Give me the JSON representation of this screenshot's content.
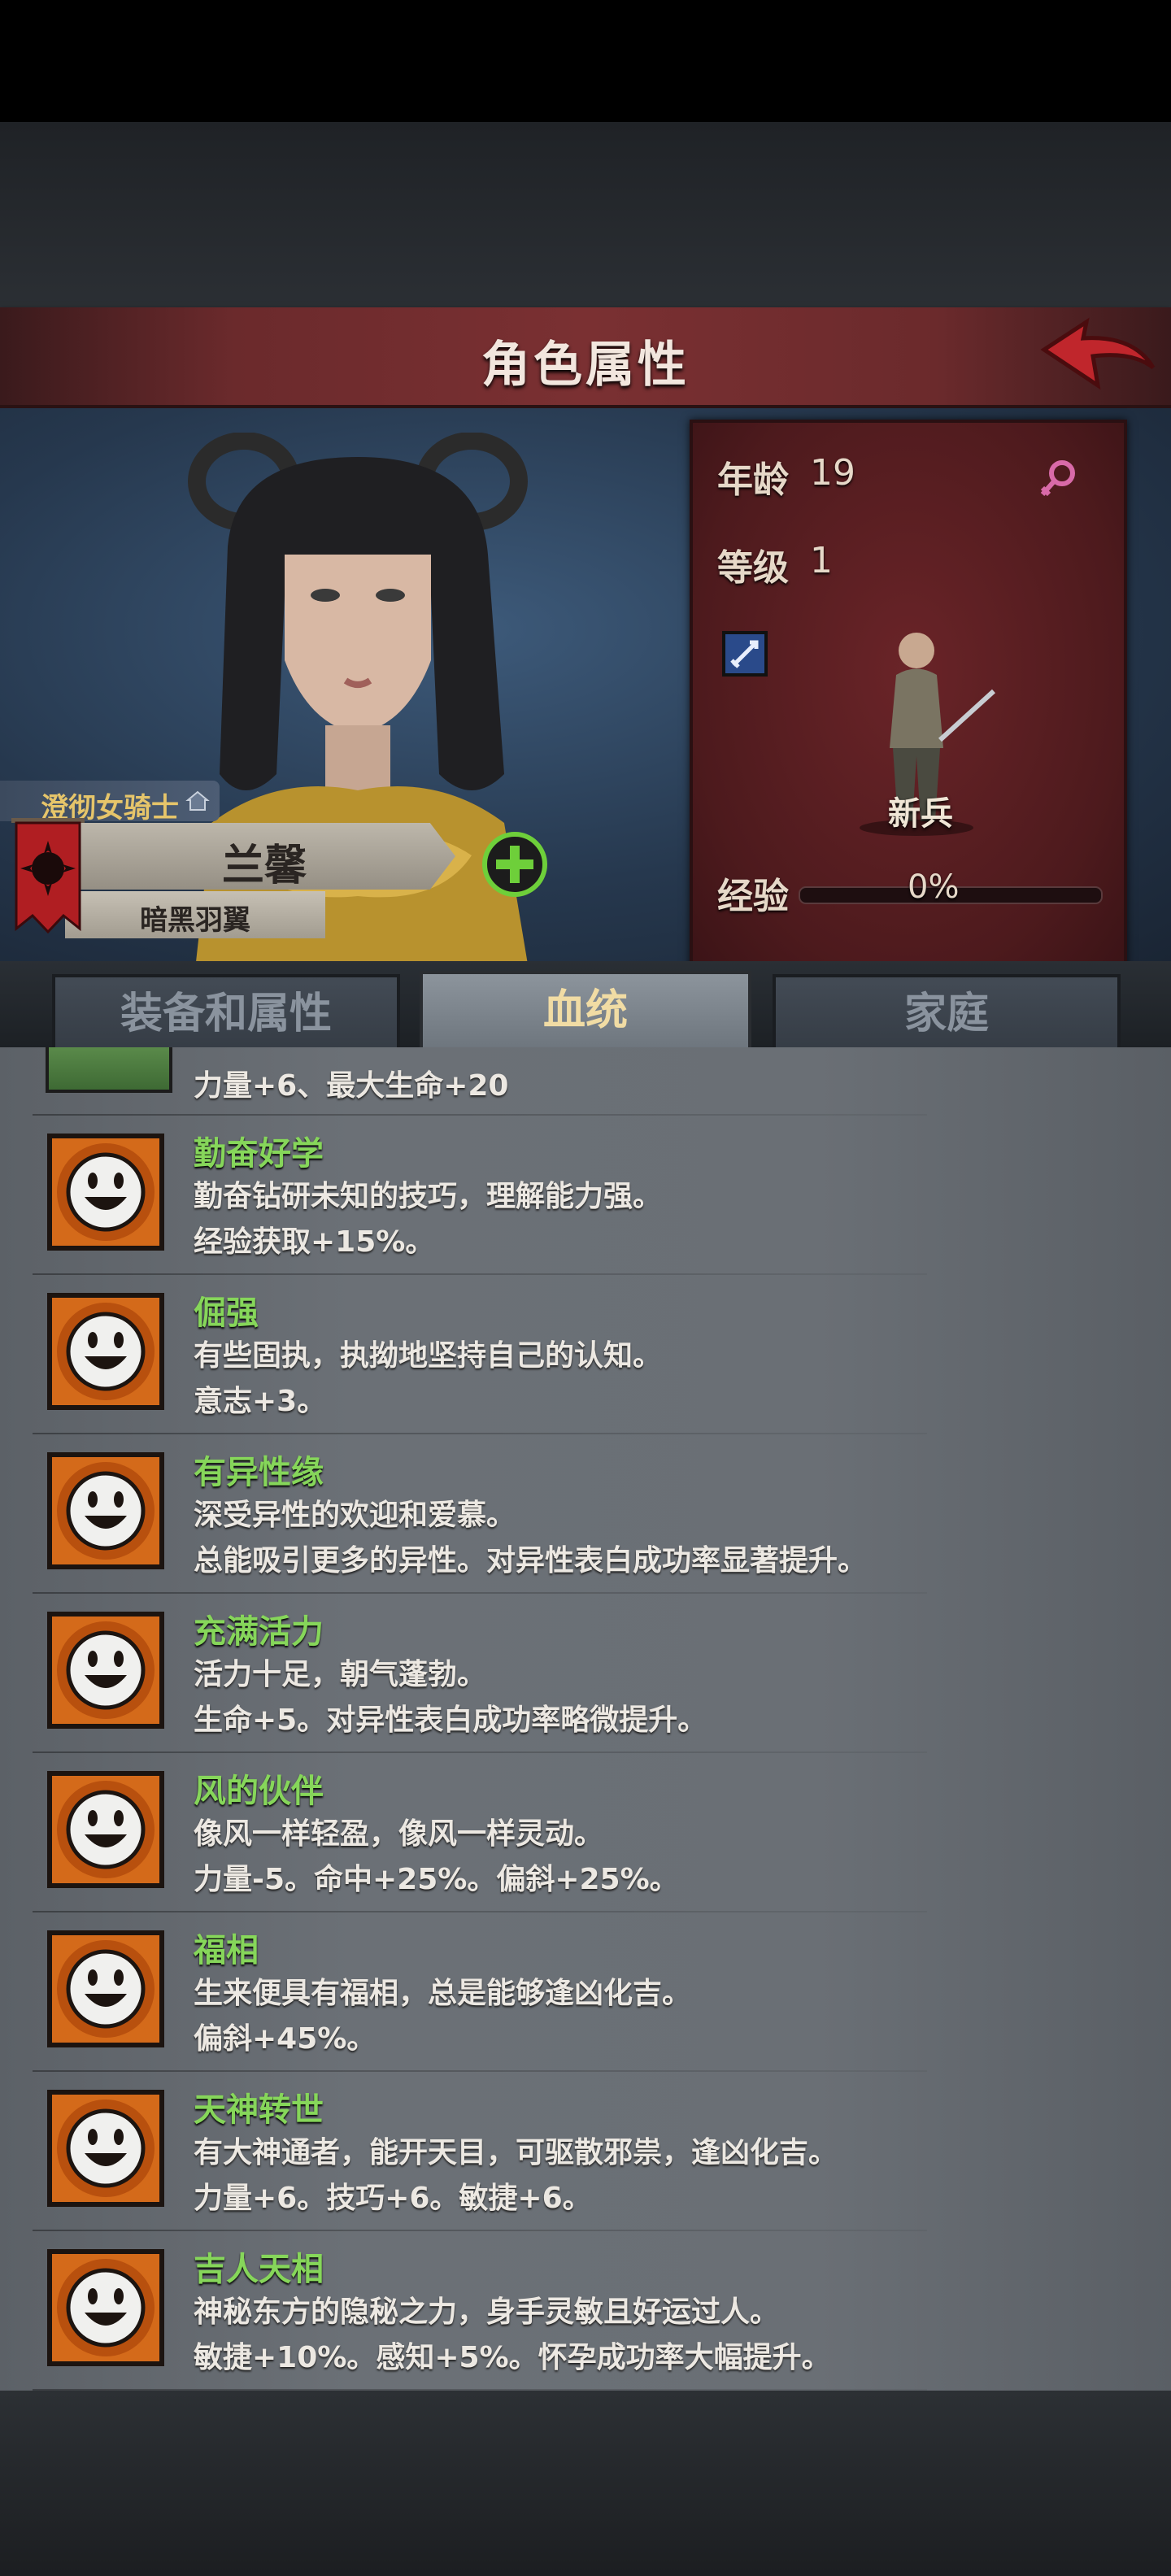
{
  "header": {
    "title": "角色属性"
  },
  "character": {
    "class_label": "澄彻女骑士",
    "name": "兰馨",
    "subtitle": "暗黑羽翼"
  },
  "stats": {
    "age_label": "年龄",
    "age_value": "19",
    "level_label": "等级",
    "level_value": "1",
    "rank": "新兵",
    "exp_label": "经验",
    "exp_value": "0%",
    "exp_fraction": 0
  },
  "tabs": [
    {
      "label": "装备和属性",
      "active": false
    },
    {
      "label": "血统",
      "active": true
    },
    {
      "label": "家庭",
      "active": false
    }
  ],
  "partial_trait": {
    "effect": "力量+6、最大生命+20"
  },
  "traits": [
    {
      "name": "勤奋好学",
      "desc": "勤奋钻研未知的技巧，理解能力强。",
      "effect": "经验获取+15%。"
    },
    {
      "name": "倔强",
      "desc": "有些固执，执拗地坚持自己的认知。",
      "effect": "意志+3。"
    },
    {
      "name": "有异性缘",
      "desc": "深受异性的欢迎和爱慕。",
      "effect": "总能吸引更多的异性。对异性表白成功率显著提升。"
    },
    {
      "name": "充满活力",
      "desc": "活力十足，朝气蓬勃。",
      "effect": "生命+5。对异性表白成功率略微提升。"
    },
    {
      "name": "风的伙伴",
      "desc": "像风一样轻盈，像风一样灵动。",
      "effect": "力量-5。命中+25%。偏斜+25%。"
    },
    {
      "name": "福相",
      "desc": "生来便具有福相，总是能够逢凶化吉。",
      "effect": "偏斜+45%。"
    },
    {
      "name": "天神转世",
      "desc": "有大神通者，能开天目，可驱散邪祟，逢凶化吉。",
      "effect": "力量+6。技巧+6。敏捷+6。"
    },
    {
      "name": "吉人天相",
      "desc": "神秘东方的隐秘之力，身手灵敏且好运过人。",
      "effect": "敏捷+10%。感知+5%。怀孕成功率大幅提升。"
    }
  ],
  "colors": {
    "trait_name": "#86d65a",
    "tab_active_text": "#f1dca4",
    "title_banner": "#6b2a2c"
  },
  "icons": [
    "back-arrow-icon",
    "female-symbol-icon",
    "sword-skill-icon",
    "plus-icon",
    "smiley-trait-icon",
    "guild-banner-icon",
    "house-icon"
  ]
}
